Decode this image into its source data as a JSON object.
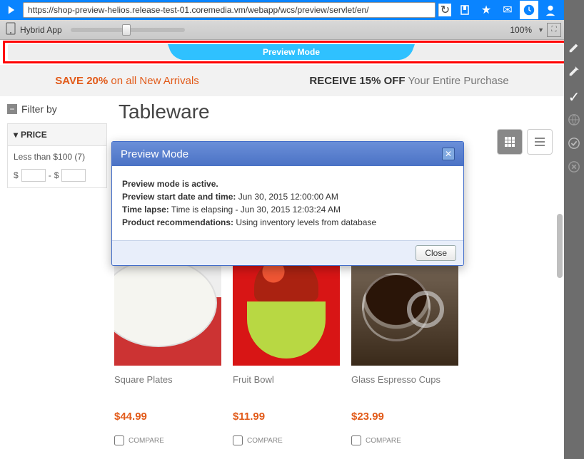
{
  "topbar": {
    "url": "https://shop-preview-helios.release-test-01.coremedia.vm/webapp/wcs/preview/servlet/en/"
  },
  "subbar": {
    "app_label": "Hybrid App",
    "zoom": "100%"
  },
  "banner": {
    "label": "Preview Mode"
  },
  "promo": {
    "left_bold": "SAVE 20%",
    "left_rest": " on all New Arrivals",
    "right_bold": "RECEIVE 15% OFF",
    "right_rest": " Your Entire Purchase"
  },
  "filter": {
    "header": "Filter by",
    "price_label": "PRICE",
    "range_label": "Less than $100 (7)",
    "currency": "$"
  },
  "page": {
    "title": "Tableware"
  },
  "products": [
    {
      "name": "Square Plates",
      "price": "$44.99",
      "compare": "COMPARE"
    },
    {
      "name": "Fruit Bowl",
      "price": "$11.99",
      "compare": "COMPARE"
    },
    {
      "name": "Glass Espresso Cups",
      "price": "$23.99",
      "compare": "COMPARE"
    }
  ],
  "modal": {
    "title": "Preview Mode",
    "l1": "Preview mode is active.",
    "l2_label": "Preview start date and time:",
    "l2_val": " Jun 30, 2015 12:00:00 AM",
    "l3_label": "Time lapse:",
    "l3_val": " Time is elapsing - Jun 30, 2015 12:03:24 AM",
    "l4_label": "Product recommendations:",
    "l4_val": " Using inventory levels from database",
    "close": "Close"
  }
}
